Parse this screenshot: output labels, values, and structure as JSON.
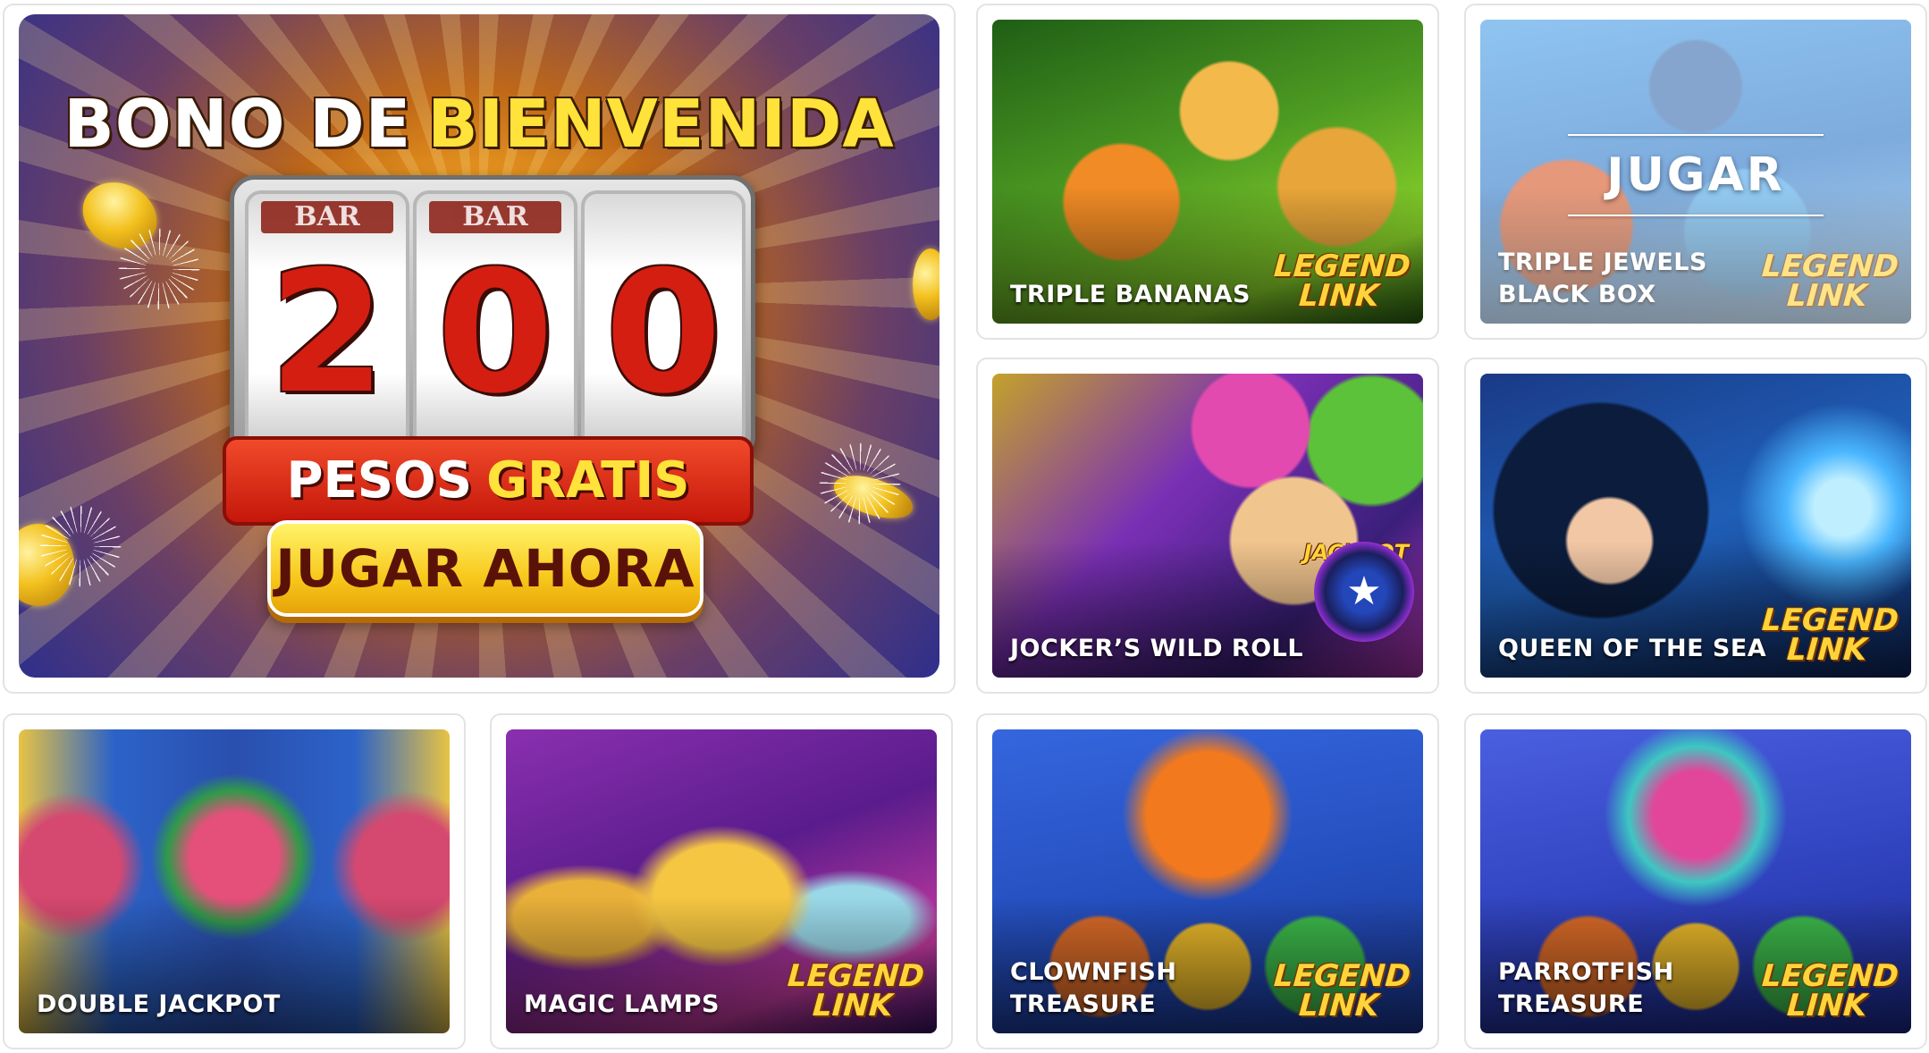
{
  "hero": {
    "title_white": "BONO DE",
    "title_yellow": "BIENVENIDA",
    "reel_label": "BAR",
    "amount_digits": [
      "2",
      "0",
      "0"
    ],
    "pesos_white": "PESOS",
    "pesos_yellow": "GRATIS",
    "cta_label": "JUGAR AHORA"
  },
  "hover": {
    "play_label": "JUGAR"
  },
  "badges": {
    "legend_link": "LEGEND\nLINK",
    "jackpot": "JACKPOT"
  },
  "games": [
    {
      "title": "TRIPLE BANANAS",
      "badge": "legend-link",
      "colors": [
        "#2f7a1c",
        "#f0a22b",
        "#7ac21f"
      ]
    },
    {
      "title": "TRIPLE JEWELS\nBLACK BOX",
      "badge": "legend-link",
      "colors": [
        "#3a8fd6",
        "#2a6fb0",
        "#c2532c"
      ]
    },
    {
      "title": "JOCKER’S WILD ROLL",
      "badge": "jackpot",
      "colors": [
        "#7a3aa8",
        "#e7b92b",
        "#3f2a7a"
      ]
    },
    {
      "title": "QUEEN OF THE SEA",
      "badge": "legend-link",
      "colors": [
        "#1f4f9e",
        "#3aa0e6",
        "#15306e"
      ]
    },
    {
      "title": "DOUBLE JACKPOT",
      "badge": "",
      "colors": [
        "#2a5fc0",
        "#d44a6a",
        "#f0c232"
      ]
    },
    {
      "title": "MAGIC LAMPS",
      "badge": "legend-link",
      "colors": [
        "#7a2bb0",
        "#e6a72a",
        "#4a1c7a"
      ]
    },
    {
      "title": "CLOWNFISH\nTREASURE",
      "badge": "legend-link",
      "colors": [
        "#2f6ad8",
        "#f07a1c",
        "#1b3f9a"
      ]
    },
    {
      "title": "PARROTFISH\nTREASURE",
      "badge": "legend-link",
      "colors": [
        "#3a57d8",
        "#e03a8a",
        "#1e2f9a"
      ]
    }
  ]
}
